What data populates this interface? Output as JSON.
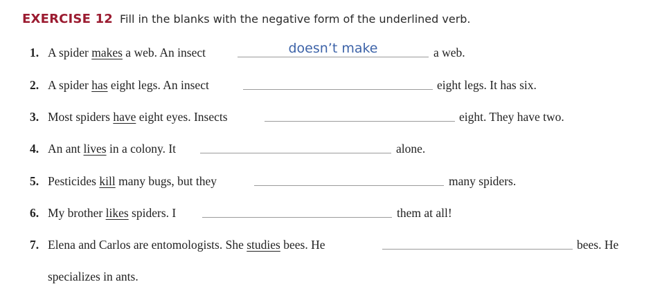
{
  "exercise": {
    "title": "EXERCISE 12",
    "instruction": "Fill in the blanks with the negative form of the underlined verb."
  },
  "items": [
    {
      "number": "1.",
      "before": "A spider ",
      "verb": "makes",
      "after": " a web. An insect",
      "answer": "doesn’t make",
      "end": "a web."
    },
    {
      "number": "2.",
      "before": "A spider ",
      "verb": "has",
      "after": " eight legs. An insect",
      "answer": "",
      "end": "eight legs. It has six."
    },
    {
      "number": "3.",
      "before": "Most spiders ",
      "verb": "have",
      "after": " eight eyes. Insects",
      "answer": "",
      "end": "eight. They have two."
    },
    {
      "number": "4.",
      "before": "An ant ",
      "verb": "lives",
      "after": " in a colony. It",
      "answer": "",
      "end": "alone."
    },
    {
      "number": "5.",
      "before": "Pesticides ",
      "verb": "kill",
      "after": " many bugs, but they",
      "answer": "",
      "end": "many spiders."
    },
    {
      "number": "6.",
      "before": "My brother ",
      "verb": "likes",
      "after": " spiders. I",
      "answer": "",
      "end": "them at all!"
    },
    {
      "number": "7.",
      "before": "Elena and Carlos are entomologists. She ",
      "verb": "studies",
      "after": " bees. He",
      "answer": "",
      "end": "bees. He",
      "continuation": "specializes in ants."
    }
  ],
  "colors": {
    "title": "#9b1b30",
    "answer_ink": "#3d63a8",
    "blank_line": "#9a9a9a"
  }
}
